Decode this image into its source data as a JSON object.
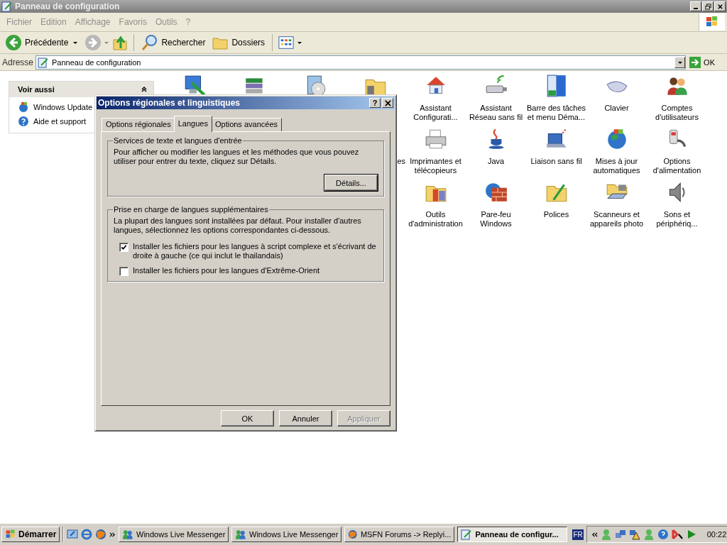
{
  "window": {
    "title": "Panneau de configuration"
  },
  "menu": [
    "Fichier",
    "Edition",
    "Affichage",
    "Favoris",
    "Outils",
    "?"
  ],
  "toolbar": {
    "back": "Précédente",
    "search": "Rechercher",
    "folders": "Dossiers"
  },
  "address": {
    "label": "Adresse",
    "value": "Panneau de configuration",
    "go": "OK"
  },
  "sidebar": {
    "title": "Voir aussi",
    "items": [
      "Windows Update",
      "Aide et support"
    ]
  },
  "icon_rows": [
    {
      "items": [
        {
          "kind": "icon"
        },
        {
          "kind": "icon"
        },
        {
          "kind": "icon"
        },
        {
          "kind": "icon"
        },
        {
          "label": "Assistant\nConfigurati..."
        },
        {
          "label": "Assistant\nRéseau sans fil"
        },
        {
          "label": "Barre des tâches\net menu Déma..."
        },
        {
          "label": "Clavier"
        },
        {
          "label": "Comptes\nd'utilisateurs"
        }
      ]
    },
    {
      "items": [
        {
          "label": "es",
          "kind": "fragment"
        },
        {
          "label": "Imprimantes et\ntélécopieurs"
        },
        {
          "label": "Java"
        },
        {
          "label": "Liaison sans fil"
        },
        {
          "label": "Mises à jour\nautomatiques"
        },
        {
          "label": "Options\nd'alimentation"
        }
      ]
    },
    {
      "items": [
        {
          "label": "Outils\nd'administration"
        },
        {
          "label": "Pare-feu\nWindows"
        },
        {
          "label": "Polices"
        },
        {
          "label": "Scanneurs et\nappareils photo"
        },
        {
          "label": "Sons et\npériphériq..."
        }
      ]
    }
  ],
  "dialog": {
    "title": "Options régionales et linguistiques",
    "help": "?",
    "tabs": [
      {
        "label": "Options régionales",
        "selected": false
      },
      {
        "label": "Langues",
        "selected": true
      },
      {
        "label": "Options avancées",
        "selected": false
      }
    ],
    "groups": [
      {
        "title": "Services de texte et langues d'entrée",
        "text": "Pour afficher ou modifier les langues et les méthodes que vous pouvez utiliser pour entrer du texte, cliquez sur Détails.",
        "button": "Détails..."
      },
      {
        "title": "Prise en charge de langues supplémentaires",
        "text": "La plupart des langues sont installées par défaut. Pour installer d'autres langues, sélectionnez les options correspondantes ci-dessous.",
        "checkboxes": [
          {
            "label": "Installer les fichiers pour les langues à script complexe et s'écrivant de droite à gauche (ce qui inclut le thailandais)",
            "checked": true
          },
          {
            "label": "Installer les fichiers pour les langues d'Extrême-Orient",
            "checked": false
          }
        ]
      }
    ],
    "buttons": [
      {
        "label": "OK",
        "disabled": false
      },
      {
        "label": "Annuler",
        "disabled": false
      },
      {
        "label": "Appliquer",
        "disabled": true
      }
    ]
  },
  "taskbar": {
    "start": "Démarrer",
    "tasks": [
      {
        "label": "Windows Live Messenger",
        "selected": false
      },
      {
        "label": "Windows Live Messenger",
        "selected": false
      },
      {
        "label": "MSFN Forums -> Replyi...",
        "selected": false
      },
      {
        "label": "Panneau de configur...",
        "selected": true
      }
    ],
    "language": "FR",
    "clock": "00:22"
  }
}
